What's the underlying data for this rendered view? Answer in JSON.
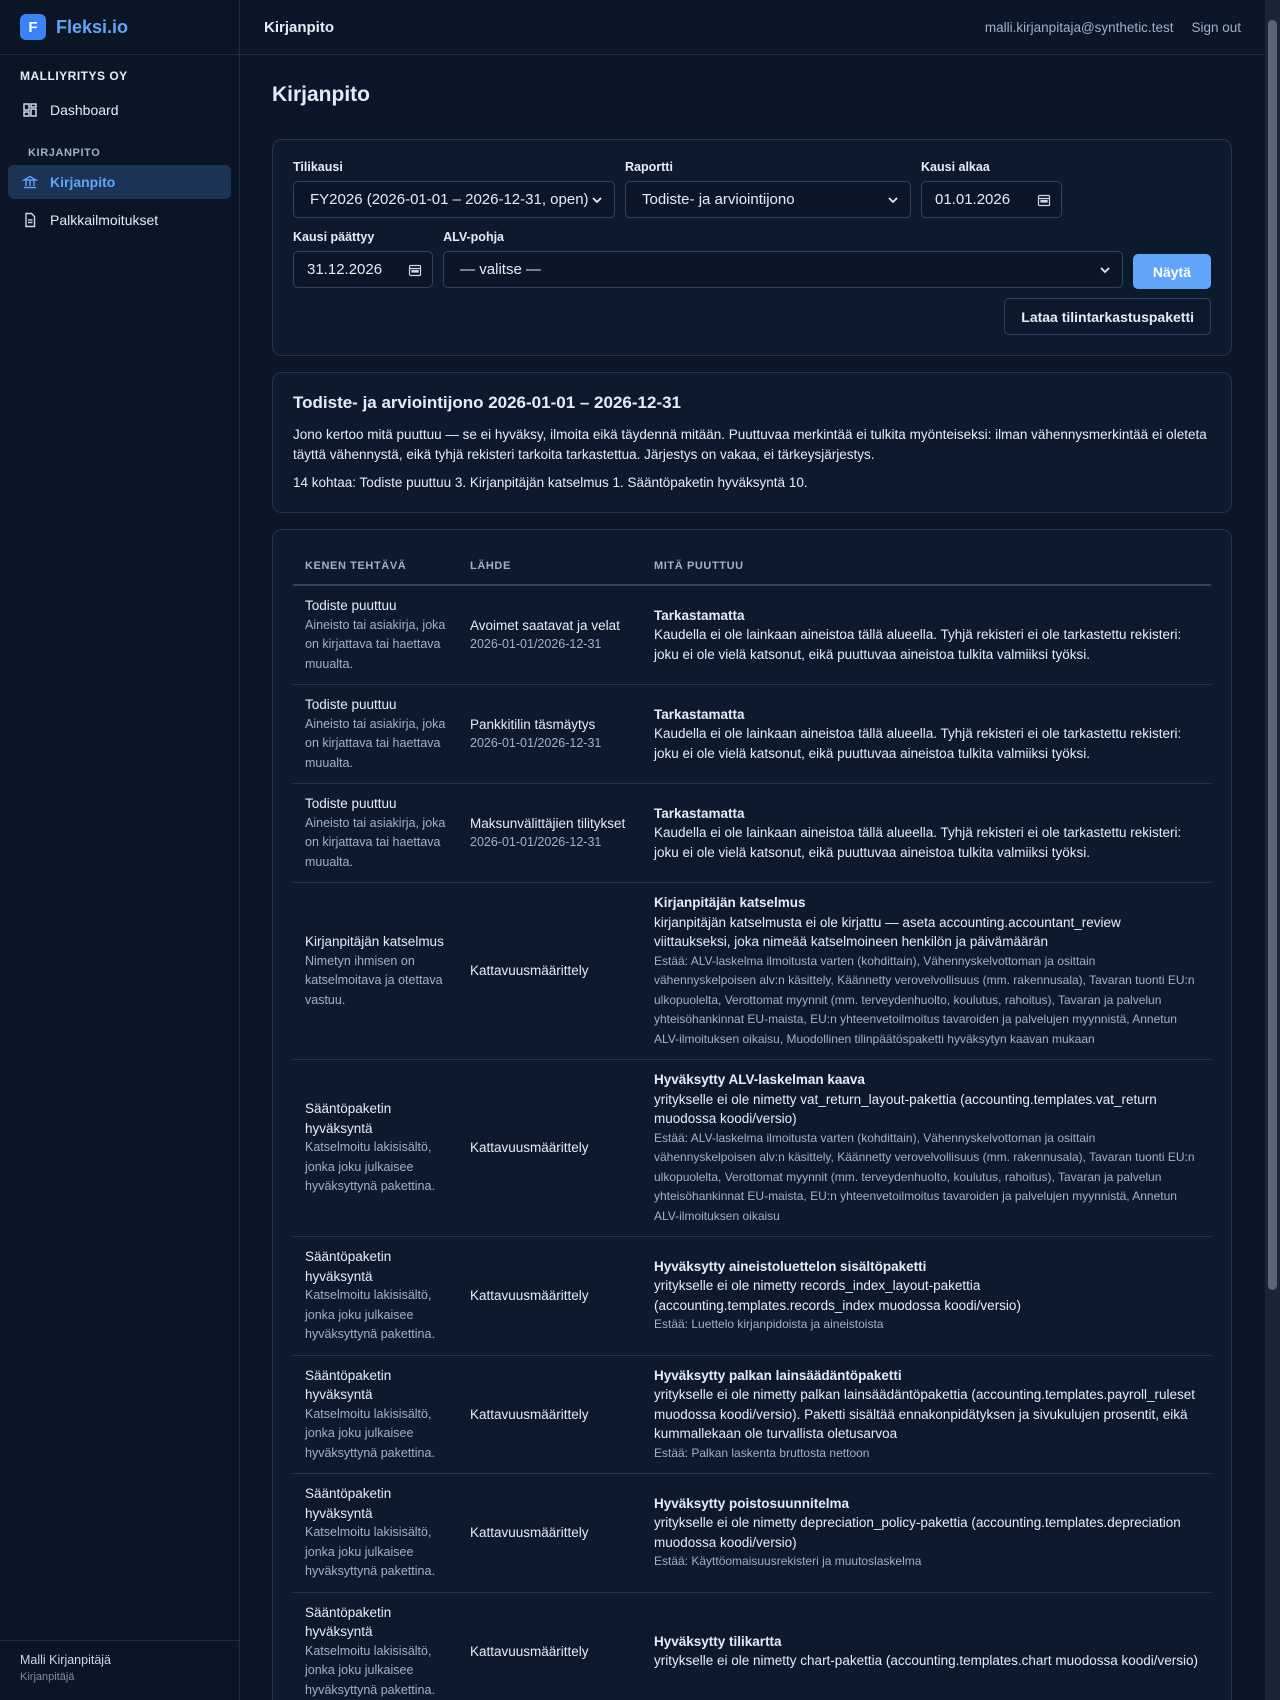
{
  "brand": {
    "logo_letter": "F",
    "name": "Fleksi.io"
  },
  "sidebar": {
    "company": "MALLIYRITYS OY",
    "items": [
      {
        "label": "Dashboard",
        "icon": "dashboard-icon"
      },
      {
        "label": "Kirjanpito",
        "icon": "bank-icon"
      },
      {
        "label": "Palkkailmoitukset",
        "icon": "document-icon"
      }
    ],
    "section": "KIRJANPITO",
    "user_name": "Malli Kirjanpitäjä",
    "user_role": "Kirjanpitäjä"
  },
  "topbar": {
    "title": "Kirjanpito",
    "email": "malli.kirjanpitaja@synthetic.test",
    "signout": "Sign out"
  },
  "page": {
    "title": "Kirjanpito"
  },
  "filters": {
    "tilikausi_label": "Tilikausi",
    "tilikausi_value": "FY2026 (2026-01-01 – 2026-12-31, open)",
    "raportti_label": "Raportti",
    "raportti_value": "Todiste- ja arviointijono",
    "alkaa_label": "Kausi alkaa",
    "alkaa_value": "01.01.2026",
    "paattyy_label": "Kausi päättyy",
    "paattyy_value": "31.12.2026",
    "alv_label": "ALV-pohja",
    "alv_value": "— valitse —",
    "show_button": "Näytä",
    "download_button": "Lataa tilintarkastuspaketti"
  },
  "summary": {
    "title": "Todiste- ja arviointijono 2026-01-01 – 2026-12-31",
    "description": "Jono kertoo mitä puuttuu — se ei hyväksy, ilmoita eikä täydennä mitään. Puuttuvaa merkintää ei tulkita myönteiseksi: ilman vähennysmerkintää ei oleteta täyttä vähennystä, eikä tyhjä rekisteri tarkoita tarkastettua. Järjestys on vakaa, ei tärkeysjärjestys.",
    "counts": "14 kohtaa: Todiste puuttuu 3. Kirjanpitäjän katselmus 1. Sääntöpaketin hyväksyntä 10."
  },
  "table": {
    "headers": [
      "KENEN TEHTÄVÄ",
      "LÄHDE",
      "MITÄ PUUTTUU"
    ],
    "rows": [
      {
        "task": "Todiste puuttuu",
        "task_desc": "Aineisto tai asiakirja, joka on kirjattava tai haettava muualta.",
        "source": "Avoimet saatavat ja velat",
        "source_date": "2026-01-01/2026-12-31",
        "missing_title": "Tarkastamatta",
        "missing_text": "Kaudella ei ole lainkaan aineistoa tällä alueella. Tyhjä rekisteri ei ole tarkastettu rekisteri: joku ei ole vielä katsonut, eikä puuttuvaa aineistoa tulkita valmiiksi työksi.",
        "blocks": ""
      },
      {
        "task": "Todiste puuttuu",
        "task_desc": "Aineisto tai asiakirja, joka on kirjattava tai haettava muualta.",
        "source": "Pankkitilin täsmäytys",
        "source_date": "2026-01-01/2026-12-31",
        "missing_title": "Tarkastamatta",
        "missing_text": "Kaudella ei ole lainkaan aineistoa tällä alueella. Tyhjä rekisteri ei ole tarkastettu rekisteri: joku ei ole vielä katsonut, eikä puuttuvaa aineistoa tulkita valmiiksi työksi.",
        "blocks": ""
      },
      {
        "task": "Todiste puuttuu",
        "task_desc": "Aineisto tai asiakirja, joka on kirjattava tai haettava muualta.",
        "source": "Maksunvälittäjien tilitykset",
        "source_date": "2026-01-01/2026-12-31",
        "missing_title": "Tarkastamatta",
        "missing_text": "Kaudella ei ole lainkaan aineistoa tällä alueella. Tyhjä rekisteri ei ole tarkastettu rekisteri: joku ei ole vielä katsonut, eikä puuttuvaa aineistoa tulkita valmiiksi työksi.",
        "blocks": ""
      },
      {
        "task": "Kirjanpitäjän katselmus",
        "task_desc": "Nimetyn ihmisen on katselmoitava ja otettava vastuu.",
        "source": "Kattavuusmäärittely",
        "source_date": "",
        "missing_title": "Kirjanpitäjän katselmus",
        "missing_text": "kirjanpitäjän katselmusta ei ole kirjattu — aseta accounting.accountant_review viittaukseksi, joka nimeää katselmoineen henkilön ja päivämäärän",
        "blocks": "Estää: ALV-laskelma ilmoitusta varten (kohdittain), Vähennyskelvottoman ja osittain vähennyskelpoisen alv:n käsittely, Käännetty verovelvollisuus (mm. rakennusala), Tavaran tuonti EU:n ulkopuolelta, Verottomat myynnit (mm. terveydenhuolto, koulutus, rahoitus), Tavaran ja palvelun yhteisöhankinnat EU-maista, EU:n yhteenvetoilmoitus tavaroiden ja palvelujen myynnistä, Annetun ALV-ilmoituksen oikaisu, Muodollinen tilinpäätöspaketti hyväksytyn kaavan mukaan"
      },
      {
        "task": "Sääntöpaketin hyväksyntä",
        "task_desc": "Katselmoitu lakisisältö, jonka joku julkaisee hyväksyttynä pakettina.",
        "source": "Kattavuusmäärittely",
        "source_date": "",
        "missing_title": "Hyväksytty ALV-laskelman kaava",
        "missing_text": "yritykselle ei ole nimetty vat_return_layout-pakettia (accounting.templates.vat_return muodossa koodi/versio)",
        "blocks": "Estää: ALV-laskelma ilmoitusta varten (kohdittain), Vähennyskelvottoman ja osittain vähennyskelpoisen alv:n käsittely, Käännetty verovelvollisuus (mm. rakennusala), Tavaran tuonti EU:n ulkopuolelta, Verottomat myynnit (mm. terveydenhuolto, koulutus, rahoitus), Tavaran ja palvelun yhteisöhankinnat EU-maista, EU:n yhteenvetoilmoitus tavaroiden ja palvelujen myynnistä, Annetun ALV-ilmoituksen oikaisu"
      },
      {
        "task": "Sääntöpaketin hyväksyntä",
        "task_desc": "Katselmoitu lakisisältö, jonka joku julkaisee hyväksyttynä pakettina.",
        "source": "Kattavuusmäärittely",
        "source_date": "",
        "missing_title": "Hyväksytty aineistoluettelon sisältöpaketti",
        "missing_text": "yritykselle ei ole nimetty records_index_layout-pakettia (accounting.templates.records_index muodossa koodi/versio)",
        "blocks": "Estää: Luettelo kirjanpidoista ja aineistoista"
      },
      {
        "task": "Sääntöpaketin hyväksyntä",
        "task_desc": "Katselmoitu lakisisältö, jonka joku julkaisee hyväksyttynä pakettina.",
        "source": "Kattavuusmäärittely",
        "source_date": "",
        "missing_title": "Hyväksytty palkan lainsäädäntöpaketti",
        "missing_text": "yritykselle ei ole nimetty palkan lainsäädäntöpakettia (accounting.templates.payroll_ruleset muodossa koodi/versio). Paketti sisältää ennakonpidätyksen ja sivukulujen prosentit, eikä kummallekaan ole turvallista oletusarvoa",
        "blocks": "Estää: Palkan laskenta bruttosta nettoon"
      },
      {
        "task": "Sääntöpaketin hyväksyntä",
        "task_desc": "Katselmoitu lakisisältö, jonka joku julkaisee hyväksyttynä pakettina.",
        "source": "Kattavuusmäärittely",
        "source_date": "",
        "missing_title": "Hyväksytty poistosuunnitelma",
        "missing_text": "yritykselle ei ole nimetty depreciation_policy-pakettia (accounting.templates.depreciation muodossa koodi/versio)",
        "blocks": "Estää: Käyttöomaisuusrekisteri ja muutoslaskelma"
      },
      {
        "task": "Sääntöpaketin hyväksyntä",
        "task_desc": "Katselmoitu lakisisältö, jonka joku julkaisee hyväksyttynä pakettina.",
        "source": "Kattavuusmäärittely",
        "source_date": "",
        "missing_title": "Hyväksytty tilikartta",
        "missing_text": "yritykselle ei ole nimetty chart-pakettia (accounting.templates.chart muodossa koodi/versio)",
        "blocks": ""
      }
    ]
  }
}
